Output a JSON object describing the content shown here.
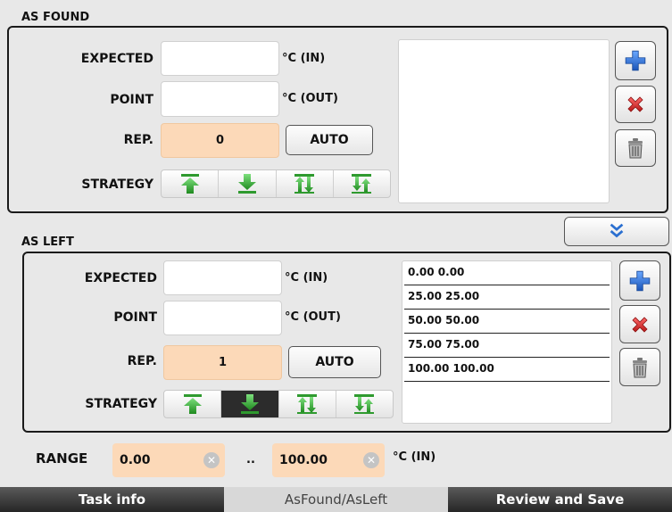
{
  "as_found": {
    "title": "AS FOUND",
    "expected_label": "EXPECTED",
    "expected_unit": "°C (IN)",
    "expected_value": "",
    "point_label": "POINT",
    "point_unit": "°C (OUT)",
    "point_value": "",
    "rep_label": "REP.",
    "rep_value": "0",
    "auto_label": "AUTO",
    "strategy_label": "STRATEGY",
    "strategy_selected": "none",
    "points": []
  },
  "as_left": {
    "title": "AS LEFT",
    "expected_label": "EXPECTED",
    "expected_unit": "°C (IN)",
    "expected_value": "",
    "point_label": "POINT",
    "point_unit": "°C (OUT)",
    "point_value": "",
    "rep_label": "REP.",
    "rep_value": "1",
    "auto_label": "AUTO",
    "strategy_label": "STRATEGY",
    "strategy_selected": "down",
    "points": [
      "0.00 0.00",
      "25.00 25.00",
      "50.00 50.00",
      "75.00 75.00",
      "100.00 100.00"
    ]
  },
  "range": {
    "label": "RANGE",
    "min": "0.00",
    "separator": "..",
    "max": "100.00",
    "unit": "°C (IN)"
  },
  "tabs": [
    {
      "label": "Task info"
    },
    {
      "label": "AsFound/AsLeft"
    },
    {
      "label": "Review and Save"
    }
  ],
  "icons": {
    "add": "plus-icon",
    "delete": "x-icon",
    "trash": "trash-icon",
    "copy_down": "double-chevron-down-icon"
  },
  "colors": {
    "accent_green": "#3aa53a",
    "add_blue": "#2f6fd0",
    "delete_red": "#d42a2a",
    "value_orange": "#fcd9b8"
  }
}
